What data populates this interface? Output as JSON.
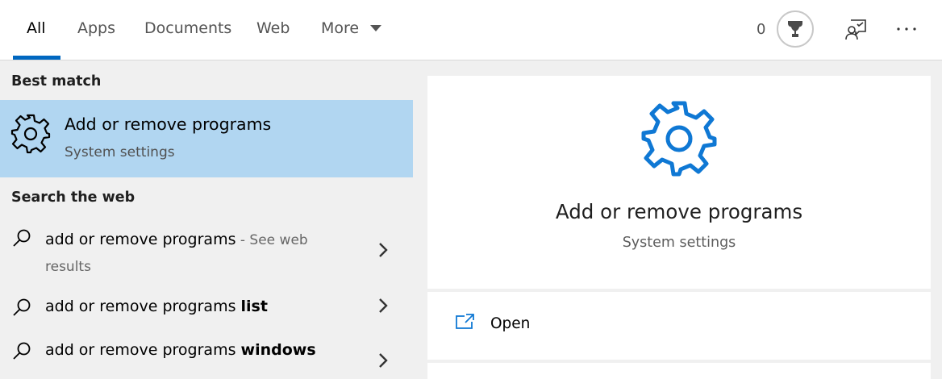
{
  "header": {
    "tabs": [
      {
        "label": "All",
        "active": true
      },
      {
        "label": "Apps",
        "active": false
      },
      {
        "label": "Documents",
        "active": false
      },
      {
        "label": "Web",
        "active": false
      },
      {
        "label": "More",
        "active": false
      }
    ],
    "points": "0",
    "icons": {
      "trophy": "trophy-icon",
      "feedback": "feedback-icon",
      "more": "ellipsis-icon"
    }
  },
  "left": {
    "best_match_header": "Best match",
    "best_match": {
      "title": "Add or remove programs",
      "subtitle": "System settings",
      "icon": "gear-icon"
    },
    "web_header": "Search the web",
    "web_results": [
      {
        "prefix": "add or remove programs",
        "bold": "",
        "suffix": " - See web results"
      },
      {
        "prefix": "add or remove programs ",
        "bold": "list",
        "suffix": ""
      },
      {
        "prefix": "add or remove programs ",
        "bold": "windows",
        "suffix": ""
      }
    ]
  },
  "right": {
    "title": "Add or remove programs",
    "subtitle": "System settings",
    "actions": [
      {
        "label": "Open",
        "icon": "open-icon"
      }
    ]
  },
  "colors": {
    "accent": "#0067c0",
    "selection": "#b1d6f1",
    "gear_blue": "#0f78d4"
  }
}
